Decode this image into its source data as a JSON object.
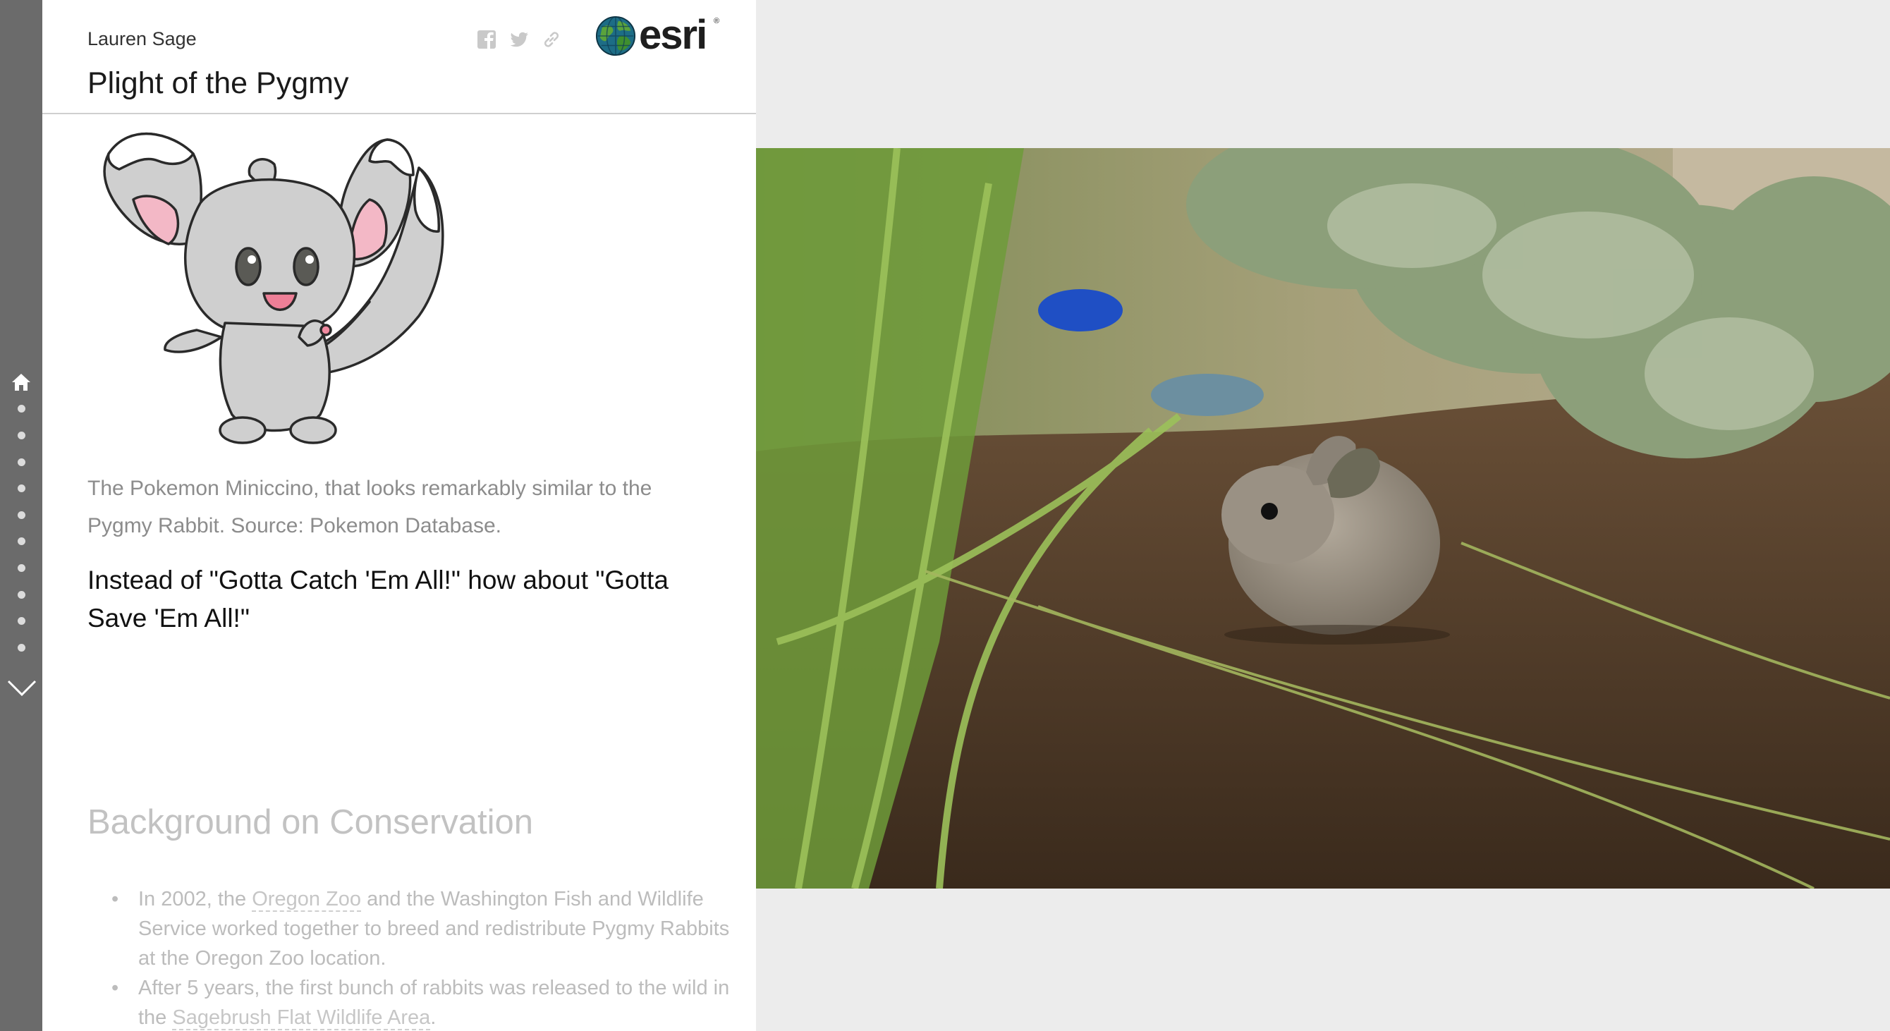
{
  "story": {
    "author": "Lauren Sage",
    "title": "Plight of the Pygmy",
    "brand": "esri",
    "brand_mark": "®"
  },
  "share_icons": [
    "facebook-icon",
    "twitter-icon",
    "link-icon"
  ],
  "nav": {
    "dot_count": 10,
    "home_icon": "home-icon",
    "next_icon": "chevron-down-icon"
  },
  "content": {
    "image_alt": "Pokemon Minccino illustration",
    "caption": "The Pokemon Miniccino, that looks remarkably similar to the Pygmy Rabbit. Source: Pokemon Database.",
    "tagline": "Instead of \"Gotta Catch 'Em All!\" how about \"Gotta Save 'Em All!\"",
    "section_heading": "Background on Conservation",
    "bullet1": {
      "pre": "In 2002, the ",
      "link": "Oregon Zoo",
      "post": " and the Washington Fish and Wildlife Service worked together to breed and redistribute Pygmy Rabbits at the Oregon Zoo location."
    },
    "bullet2": {
      "pre": "After 5 years, the first bunch of rabbits was released to the wild in the ",
      "link": "Sagebrush Flat Wildlife Area",
      "post": "."
    }
  },
  "media": {
    "photo_alt": "Pygmy rabbit sitting on soil beneath sagebrush and grass"
  },
  "colors": {
    "rail": "#6b6b6b",
    "panel": "#ffffff",
    "media_bg": "#ececec",
    "muted_text": "#8c8c8c",
    "faded_text": "#bcbcbc"
  }
}
